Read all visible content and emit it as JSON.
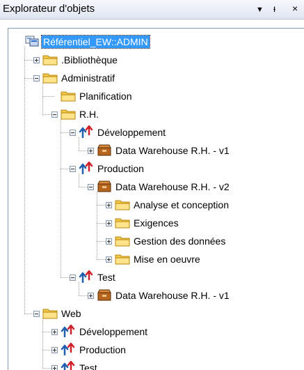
{
  "panel": {
    "title": "Explorateur d'objets",
    "buttons": {
      "dropdown": "▼",
      "pin": "ᵻ",
      "close": "×"
    }
  },
  "tree": [
    {
      "label": "Référentiel_EW::ADMIN",
      "icon": "repository-icon",
      "depth": 0,
      "expander": "none",
      "selected": true
    },
    {
      "label": ".Bibliothèque",
      "icon": "folder-icon",
      "depth": 1,
      "expander": "plus"
    },
    {
      "label": "Administratif",
      "icon": "folder-icon",
      "depth": 1,
      "expander": "minus"
    },
    {
      "label": "Planification",
      "icon": "folder-icon",
      "depth": 2,
      "expander": "none"
    },
    {
      "label": "R.H.",
      "icon": "folder-icon",
      "depth": 2,
      "expander": "minus"
    },
    {
      "label": "Développement",
      "icon": "environment-icon",
      "depth": 3,
      "expander": "minus"
    },
    {
      "label": "Data Warehouse R.H. - v1",
      "icon": "model-icon",
      "depth": 4,
      "expander": "plus"
    },
    {
      "label": "Production",
      "icon": "environment-icon",
      "depth": 3,
      "expander": "minus"
    },
    {
      "label": "Data Warehouse R.H. - v2",
      "icon": "model-icon",
      "depth": 4,
      "expander": "minus"
    },
    {
      "label": "Analyse et conception",
      "icon": "folder-icon",
      "depth": 5,
      "expander": "plus"
    },
    {
      "label": "Exigences",
      "icon": "folder-icon",
      "depth": 5,
      "expander": "plus"
    },
    {
      "label": "Gestion des données",
      "icon": "folder-icon",
      "depth": 5,
      "expander": "plus"
    },
    {
      "label": "Mise en oeuvre",
      "icon": "folder-icon",
      "depth": 5,
      "expander": "plus"
    },
    {
      "label": "Test",
      "icon": "environment-icon",
      "depth": 3,
      "expander": "minus"
    },
    {
      "label": "Data Warehouse R.H. - v1",
      "icon": "model-icon",
      "depth": 4,
      "expander": "plus"
    },
    {
      "label": "Web",
      "icon": "folder-icon",
      "depth": 1,
      "expander": "minus"
    },
    {
      "label": "Développement",
      "icon": "environment-icon",
      "depth": 2,
      "expander": "plus"
    },
    {
      "label": "Production",
      "icon": "environment-icon",
      "depth": 2,
      "expander": "plus"
    },
    {
      "label": "Test",
      "icon": "environment-icon",
      "depth": 2,
      "expander": "plus"
    }
  ]
}
